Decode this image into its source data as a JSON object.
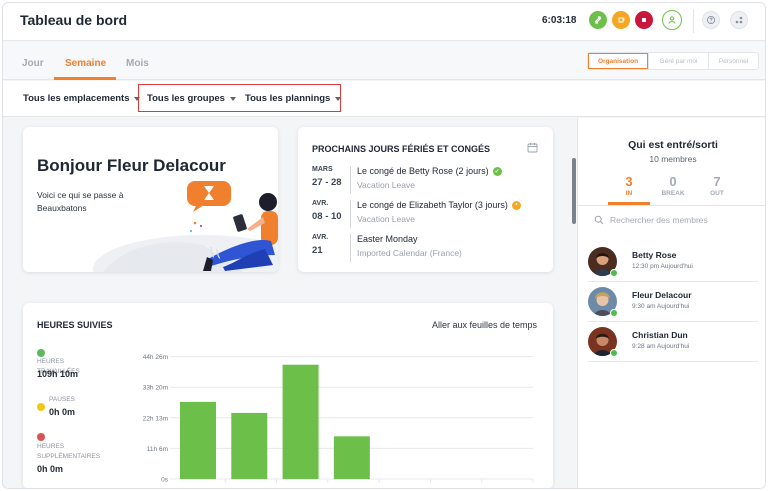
{
  "header": {
    "title": "Tableau de bord",
    "clock": "6:03:18",
    "colors": {
      "accent": "#f07f2e",
      "green": "#6cc04a",
      "orange": "#f6a623",
      "red": "#c8163d"
    }
  },
  "tabs": [
    {
      "label": "Jour",
      "active": false
    },
    {
      "label": "Semaine",
      "active": true
    },
    {
      "label": "Mois",
      "active": false
    }
  ],
  "scope": {
    "options": [
      "Organisation",
      "Géré par moi",
      "Personnel"
    ],
    "selected": "Organisation"
  },
  "filters": {
    "locations": "Tous les emplacements",
    "groups": "Tous les groupes",
    "schedules": "Tous les plannings"
  },
  "welcome": {
    "title": "Bonjour Fleur Delacour",
    "subtitle": "Voici ce qui se passe à Beauxbatons"
  },
  "holidays": {
    "title": "PROCHAINS JOURS FÉRIÉS ET CONGÉS",
    "items": [
      {
        "month": "MARS",
        "days": "27 - 28",
        "name": "Le congé de Betty Rose (2 jours)",
        "type": "Vacation Leave",
        "status": "approved"
      },
      {
        "month": "AVR.",
        "days": "08 - 10",
        "name": "Le congé de Elizabeth Taylor (3 jours)",
        "type": "Vacation Leave",
        "status": "pending"
      },
      {
        "month": "AVR.",
        "days": "21",
        "name": "Easter Monday",
        "type": "Imported Calendar (France)",
        "status": ""
      }
    ]
  },
  "hours": {
    "title": "HEURES SUIVIES",
    "link": "Aller aux feuilles de temps",
    "stats": [
      {
        "label": "HEURES TRAVAILLÉES",
        "value": "109h 10m",
        "color": "#5cb85c"
      },
      {
        "label": "PAUSES",
        "value": "0h 0m",
        "color": "#f5c518"
      },
      {
        "label": "HEURES SUPPLÉMENTAIRES",
        "value": "0h 0m",
        "color": "#d9534f"
      }
    ]
  },
  "chart_data": {
    "type": "bar",
    "ylim": [
      0,
      44.3
    ],
    "y_ticks": [
      {
        "label": "44h 26m",
        "value": 44.43
      },
      {
        "label": "33h 20m",
        "value": 33.33
      },
      {
        "label": "22h 13m",
        "value": 22.22
      },
      {
        "label": "11h 6m",
        "value": 11.1
      },
      {
        "label": "0s",
        "value": 0
      }
    ],
    "values": [
      28,
      24,
      41.5,
      15.5,
      0,
      0,
      0
    ],
    "bar_color": "#6cc04a",
    "grid": true
  },
  "who": {
    "title": "Qui est entré/sorti",
    "subtitle": "10 membres",
    "counters": [
      {
        "value": "3",
        "label": "IN",
        "active": true
      },
      {
        "value": "0",
        "label": "BREAK",
        "active": false
      },
      {
        "value": "7",
        "label": "OUT",
        "active": false
      }
    ],
    "search_placeholder": "Rechercher des membres",
    "members": [
      {
        "name": "Betty Rose",
        "time": "12:30 pm Aujourd'hui"
      },
      {
        "name": "Fleur Delacour",
        "time": "9:30 am Aujourd'hui"
      },
      {
        "name": "Christian Dun",
        "time": "9:28 am Aujourd'hui"
      }
    ]
  }
}
